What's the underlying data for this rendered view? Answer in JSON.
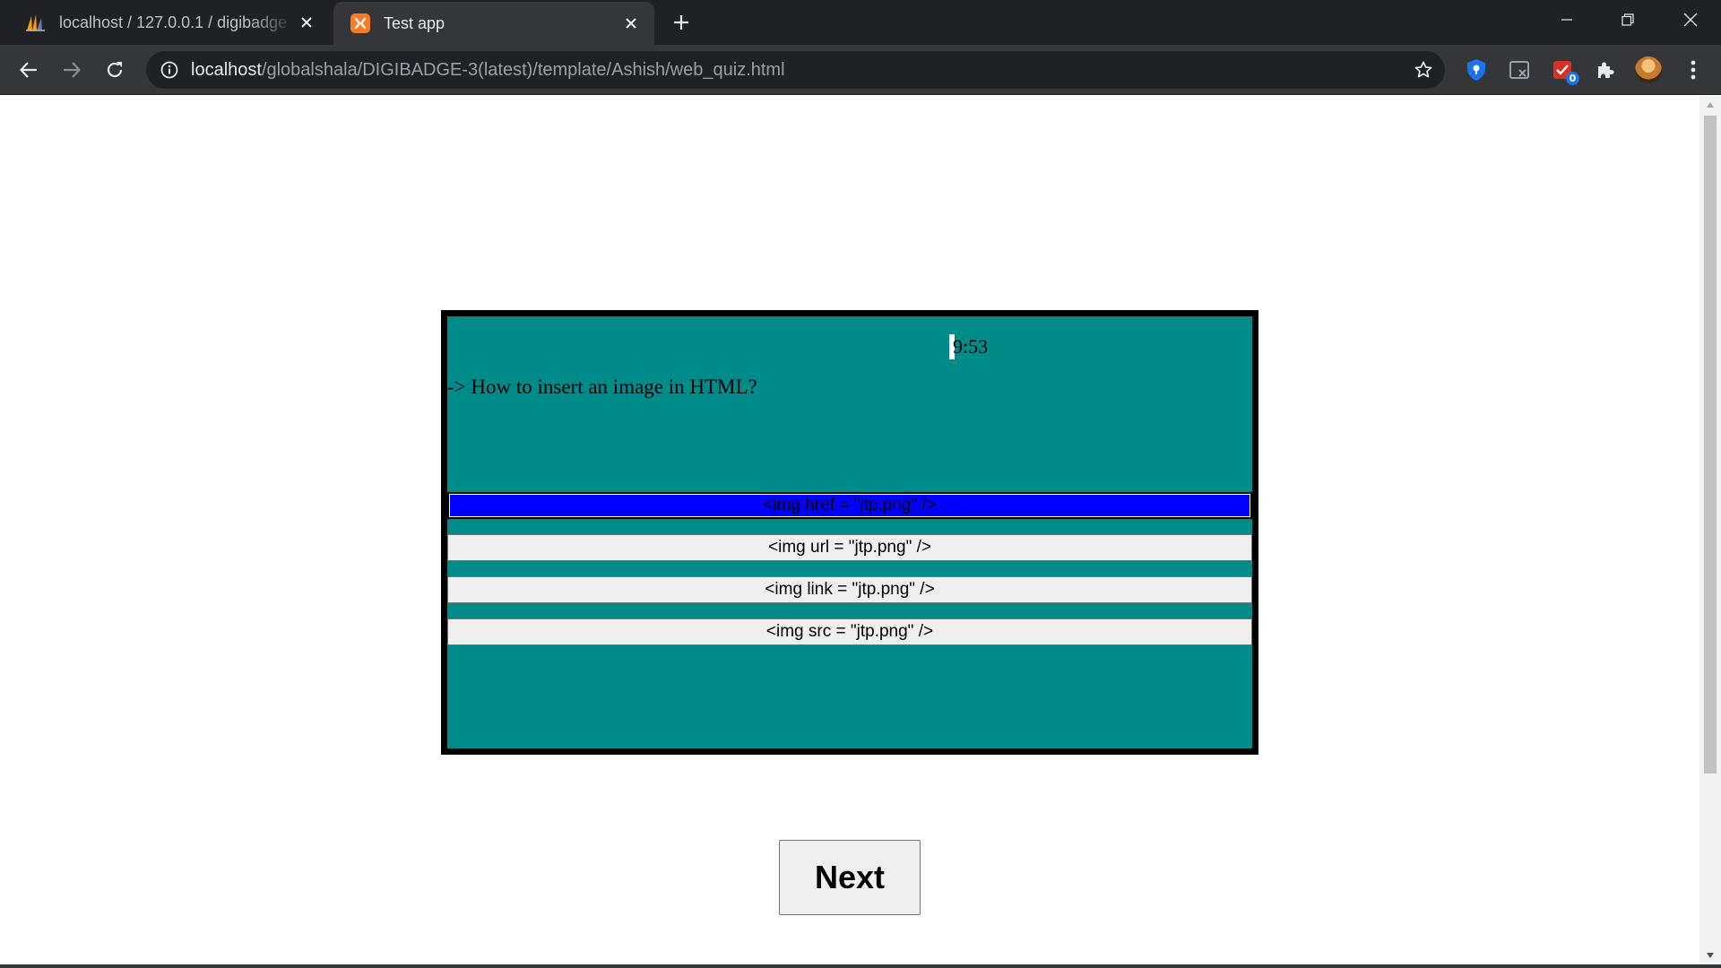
{
  "browser": {
    "tabs": [
      {
        "title": "localhost / 127.0.0.1 / digibadge",
        "favicon": "phpmyadmin-sail-icon",
        "active": false
      },
      {
        "title": "Test app",
        "favicon": "xampp-icon",
        "active": true
      }
    ],
    "address": {
      "host": "localhost",
      "path": "/globalshala/DIGIBADGE-3(latest)/template/Ashish/web_quiz.html"
    },
    "extensions": [
      {
        "name": "shield-extension-icon"
      },
      {
        "name": "screen-off-extension-icon"
      },
      {
        "name": "alert-extension-icon",
        "badge": "0"
      },
      {
        "name": "puzzle-extensions-icon"
      },
      {
        "name": "profile-avatar"
      },
      {
        "name": "kebab-menu-icon"
      }
    ]
  },
  "quiz": {
    "timer": "9:53",
    "question": "-> How to insert an image in HTML?",
    "options": [
      {
        "label": "<img href = \"jtp.png\" />",
        "selected": true
      },
      {
        "label": "<img url = \"jtp.png\" />",
        "selected": false
      },
      {
        "label": "<img link = \"jtp.png\" />",
        "selected": false
      },
      {
        "label": "<img src = \"jtp.png\" />",
        "selected": false
      }
    ],
    "next_label": "Next"
  },
  "colors": {
    "quiz_background": "#008b8b",
    "selected_option": "#0000ff",
    "chrome_dark": "#202124",
    "chrome_toolbar": "#35363a"
  }
}
